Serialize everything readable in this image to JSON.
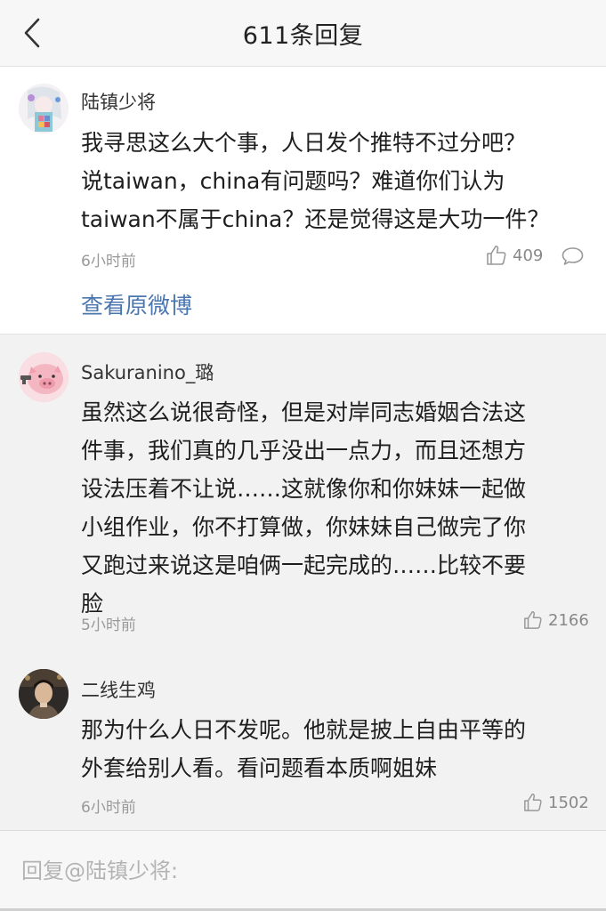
{
  "header": {
    "back_icon": "chevron-left-icon",
    "title": "611条回复"
  },
  "main_comment": {
    "username": "陆镇少将",
    "text": "我寻思这么大个事，人日发个推特不过分吧？\n说taiwan，china有问题吗？难道你们认为\ntaiwan不属于china？还是觉得这是大功一件？",
    "time": "6小时前",
    "likes": "409",
    "like_icon": "thumbs-up-icon",
    "reply_icon": "comment-bubble-icon",
    "view_original": "查看原微博"
  },
  "replies": [
    {
      "username": "Sakuranino_璐",
      "text": "虽然这么说很奇怪，但是对岸同志婚姻合法这\n件事，我们真的几乎没出一点力，而且还想方\n设法压着不让说……这就像你和你妹妹一起做\n小组作业，你不打算做，你妹妹自己做完了你\n又跑过来说这是咱俩一起完成的……比较不要\n脸",
      "time": "5小时前",
      "likes": "2166"
    },
    {
      "username": "二线生鸡",
      "text": "那为什么人日不发呢。他就是披上自由平等的\n外套给别人看。看问题看本质啊姐妹",
      "time": "6小时前",
      "likes": "1502"
    }
  ],
  "reply_bar": {
    "placeholder": "回复@陆镇少将:"
  },
  "colors": {
    "link": "#4a76b0",
    "meta": "#999999",
    "page_bg": "#f2f2f2"
  }
}
